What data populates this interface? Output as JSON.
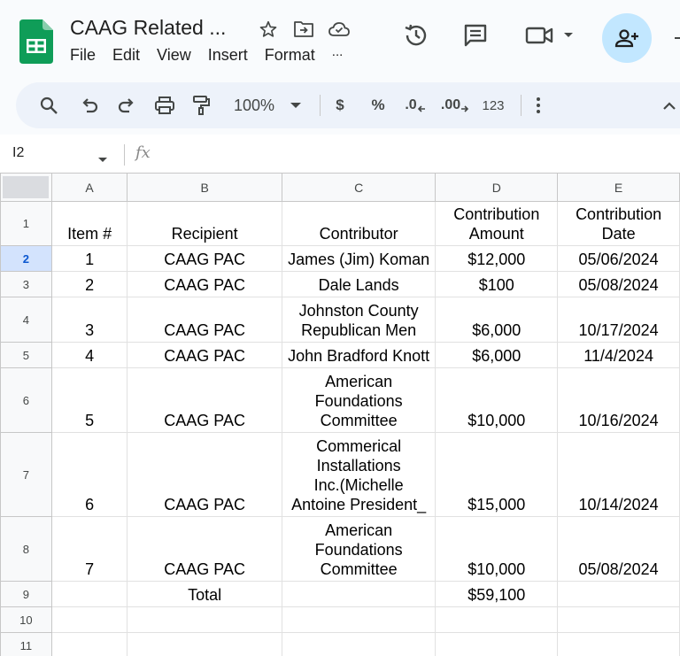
{
  "doc": {
    "title": "CAAG Related ..."
  },
  "menu": [
    "File",
    "Edit",
    "View",
    "Insert",
    "Format",
    "..."
  ],
  "toolbar": {
    "zoom": "100%",
    "currency": "$",
    "percent": "%",
    "dec_decrease": ".0",
    "dec_increase": ".00",
    "number_format": "123"
  },
  "formula_bar": {
    "cell_ref": "I2",
    "fx": "fx",
    "value": ""
  },
  "columns": [
    "A",
    "B",
    "C",
    "D",
    "E"
  ],
  "rows": [
    {
      "num": "1",
      "cells": [
        "Item #",
        "Recipient",
        "Contributor",
        "Contribution\nAmount",
        "Contribution\nDate"
      ]
    },
    {
      "num": "2",
      "cells": [
        "1",
        "CAAG PAC",
        "James (Jim) Koman",
        "$12,000",
        "05/06/2024"
      ]
    },
    {
      "num": "3",
      "cells": [
        "2",
        "CAAG PAC",
        "Dale Lands",
        "$100",
        "05/08/2024"
      ]
    },
    {
      "num": "4",
      "cells": [
        "3",
        "CAAG PAC",
        "Johnston County\nRepublican Men",
        "$6,000",
        "10/17/2024"
      ]
    },
    {
      "num": "5",
      "cells": [
        "4",
        "CAAG PAC",
        "John Bradford Knott",
        "$6,000",
        "11/4/2024"
      ]
    },
    {
      "num": "6",
      "cells": [
        "5",
        "CAAG PAC",
        "American\nFoundations\nCommittee",
        "$10,000",
        "10/16/2024"
      ]
    },
    {
      "num": "7",
      "cells": [
        "6",
        "CAAG PAC",
        "Commerical\nInstallations\nInc.(Michelle\nAntoine President_",
        "$15,000",
        "10/14/2024"
      ]
    },
    {
      "num": "8",
      "cells": [
        "7",
        "CAAG PAC",
        "American\nFoundations\nCommittee",
        "$10,000",
        "05/08/2024"
      ]
    },
    {
      "num": "9",
      "cells": [
        "",
        "Total",
        "",
        "$59,100",
        ""
      ]
    },
    {
      "num": "10",
      "cells": [
        "",
        "",
        "",
        "",
        ""
      ]
    },
    {
      "num": "11",
      "cells": [
        "",
        "",
        "",
        "",
        ""
      ]
    }
  ],
  "selected_row": "2",
  "colors": {
    "selected_header_bg": "#d3e3fd",
    "selected_header_text": "#0b57d0",
    "share_bg": "#c2e7ff",
    "logo_green": "#0f9d58"
  }
}
